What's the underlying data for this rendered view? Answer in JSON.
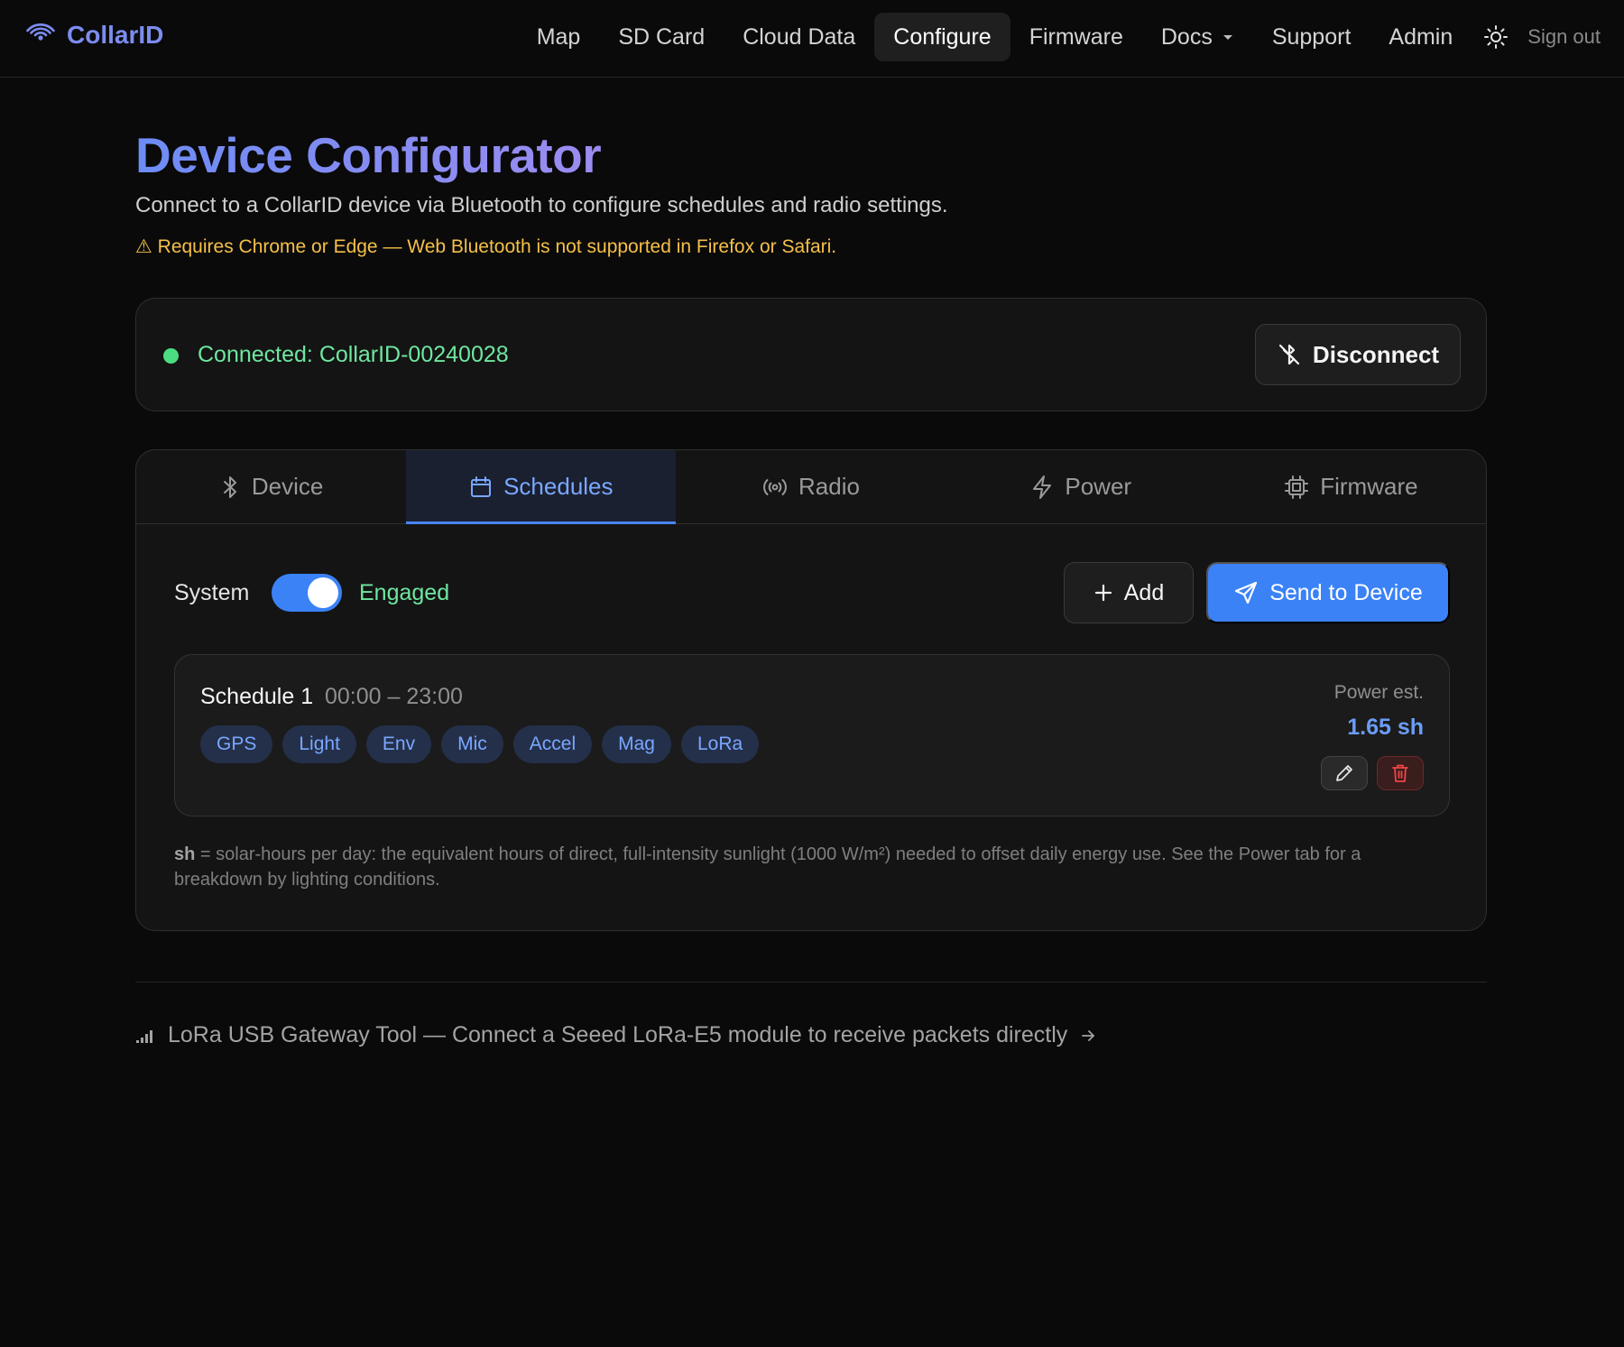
{
  "brand": {
    "name": "CollarID"
  },
  "nav": {
    "items": [
      {
        "label": "Map"
      },
      {
        "label": "SD Card"
      },
      {
        "label": "Cloud Data"
      },
      {
        "label": "Configure"
      },
      {
        "label": "Firmware"
      },
      {
        "label": "Docs"
      },
      {
        "label": "Support"
      },
      {
        "label": "Admin"
      }
    ],
    "active": "Configure",
    "sign_out": "Sign out"
  },
  "header": {
    "title": "Device Configurator",
    "subtitle": "Connect to a CollarID device via Bluetooth to configure schedules and radio settings.",
    "warning": "⚠ Requires Chrome or Edge — Web Bluetooth is not supported in Firefox or Safari."
  },
  "connection": {
    "status": "Connected: CollarID-00240028",
    "disconnect_label": "Disconnect"
  },
  "tabs": [
    {
      "label": "Device",
      "icon": "bluetooth-icon"
    },
    {
      "label": "Schedules",
      "icon": "calendar-icon"
    },
    {
      "label": "Radio",
      "icon": "radio-icon"
    },
    {
      "label": "Power",
      "icon": "lightning-icon"
    },
    {
      "label": "Firmware",
      "icon": "chip-icon"
    }
  ],
  "active_tab": "Schedules",
  "schedules_panel": {
    "system_label": "System",
    "system_state": "Engaged",
    "system_enabled": true,
    "add_label": "Add",
    "send_label": "Send to Device",
    "schedules": [
      {
        "name": "Schedule 1",
        "time": "00:00 – 23:00",
        "sensors": [
          "GPS",
          "Light",
          "Env",
          "Mic",
          "Accel",
          "Mag",
          "LoRa"
        ],
        "power_label": "Power est.",
        "power_value": "1.65 sh"
      }
    ],
    "footnote_term": "sh",
    "footnote_text": " = solar-hours per day: the equivalent hours of direct, full-intensity sunlight (1000 W/m²) needed to offset daily energy use. See the Power tab for a breakdown by lighting conditions."
  },
  "footer": {
    "gateway_link": "LoRa USB Gateway Tool — Connect a Seeed LoRa-E5 module to receive packets directly"
  },
  "colors": {
    "accent": "#3b82f6",
    "success": "#4ade80",
    "warning": "#f5c04a",
    "danger": "#ef4444",
    "background": "#0a0a0a"
  }
}
